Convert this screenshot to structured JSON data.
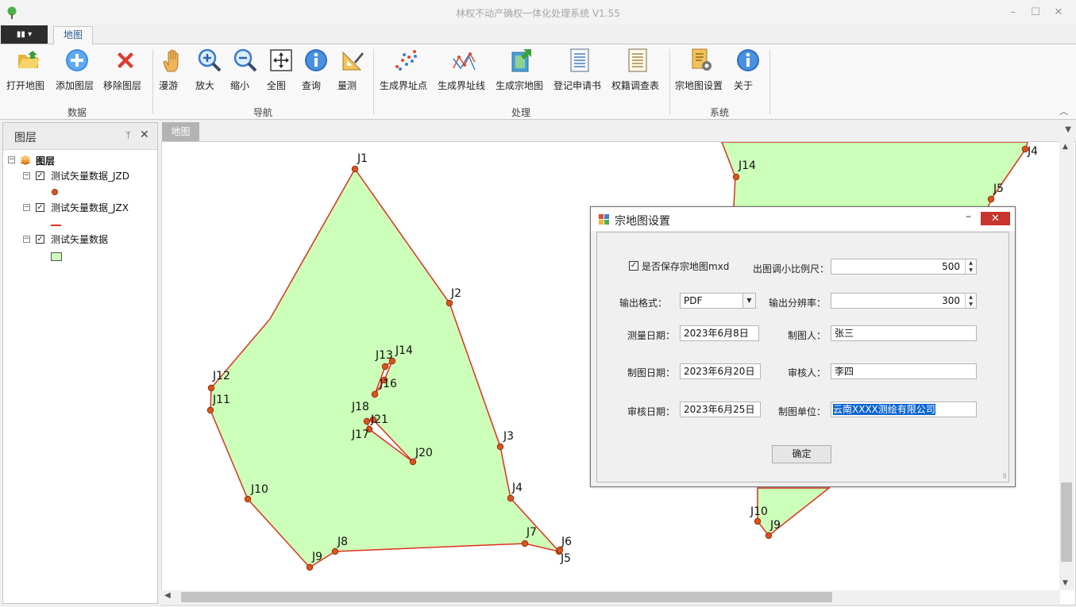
{
  "window": {
    "title": "林权不动产确权一体化处理系统 V1.55",
    "controls": {
      "minimize": "–",
      "maximize": "☐",
      "close": "✕"
    }
  },
  "ribbon": {
    "app_menu_label": "▮▮ ▾",
    "tabs": [
      "地图"
    ],
    "groups": [
      {
        "label": "数据",
        "buttons": [
          {
            "label": "打开地图",
            "icon": "open-folder-icon"
          },
          {
            "label": "添加图层",
            "icon": "add-layer-icon"
          },
          {
            "label": "移除图层",
            "icon": "remove-layer-icon"
          }
        ]
      },
      {
        "label": "导航",
        "buttons": [
          {
            "label": "漫游",
            "icon": "pan-hand-icon"
          },
          {
            "label": "放大",
            "icon": "zoom-in-icon"
          },
          {
            "label": "缩小",
            "icon": "zoom-out-icon"
          },
          {
            "label": "全图",
            "icon": "full-extent-icon"
          },
          {
            "label": "查询",
            "icon": "identify-icon"
          },
          {
            "label": "量测",
            "icon": "measure-icon"
          }
        ]
      },
      {
        "label": "处理",
        "buttons": [
          {
            "label": "生成界址点",
            "icon": "boundary-points-icon"
          },
          {
            "label": "生成界址线",
            "icon": "boundary-lines-icon"
          },
          {
            "label": "生成宗地图",
            "icon": "parcel-map-icon"
          },
          {
            "label": "登记申请书",
            "icon": "document-icon"
          },
          {
            "label": "权籍调查表",
            "icon": "document-icon"
          }
        ]
      },
      {
        "label": "系统",
        "buttons": [
          {
            "label": "宗地图设置",
            "icon": "parcel-settings-icon"
          },
          {
            "label": "关于",
            "icon": "info-icon"
          }
        ]
      }
    ]
  },
  "layers_panel": {
    "title": "图层",
    "root": "图层",
    "layers": [
      {
        "name": "测试矢量数据_JZD",
        "checked": true,
        "symbol": "point"
      },
      {
        "name": "测试矢量数据_JZX",
        "checked": true,
        "symbol": "line"
      },
      {
        "name": "测试矢量数据",
        "checked": true,
        "symbol": "polygon"
      }
    ]
  },
  "map": {
    "tab_label": "地图",
    "fill_color": "#ccffb9",
    "line_color": "#e0301e",
    "point_color": "#d9531e",
    "point_labels_main": [
      "J1",
      "J2",
      "J3",
      "J4",
      "J5",
      "J6",
      "J7",
      "J8",
      "J9",
      "J10",
      "J11",
      "J12",
      "J13",
      "J14",
      "J16",
      "J17",
      "J18",
      "J20",
      "J21"
    ],
    "point_labels_right": [
      "J14",
      "J4",
      "J5",
      "J10",
      "J9"
    ]
  },
  "dialog": {
    "title": "宗地图设置",
    "save_mxd_label": "是否保存宗地图mxd",
    "save_mxd_checked": true,
    "scale_label": "出图调小比例尺：",
    "scale_value": "500",
    "format_label": "输出格式：",
    "format_value": "PDF",
    "resolution_label": "输出分辨率：",
    "resolution_value": "300",
    "survey_date_label": "测量日期：",
    "survey_date_value": "2023年6月8日",
    "drafter_label": "制图人：",
    "drafter_value": "张三",
    "draft_date_label": "制图日期：",
    "draft_date_value": "2023年6月20日",
    "reviewer_label": "审核人：",
    "reviewer_value": "李四",
    "review_date_label": "审核日期：",
    "review_date_value": "2023年6月25日",
    "org_label": "制图单位：",
    "org_value": "云南XXXX测绘有限公司",
    "ok_label": "确定"
  }
}
